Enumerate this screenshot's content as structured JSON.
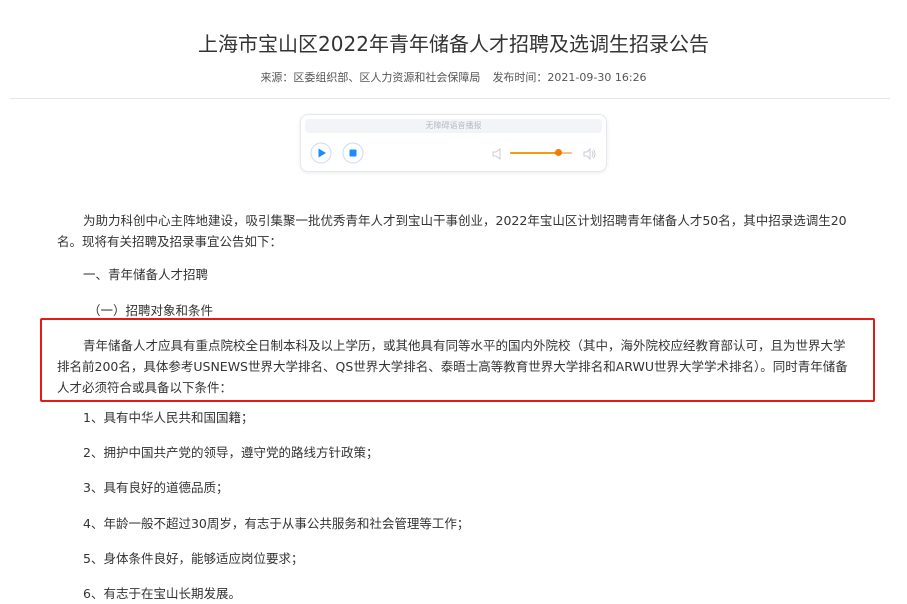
{
  "article": {
    "title": "上海市宝山区2022年青年储备人才招聘及选调生招录公告",
    "source_label": "来源：区委组织部、区人力资源和社会保障局",
    "publish_label": "发布时间：2021-09-30 16:26"
  },
  "player": {
    "banner": "无障碍语音播报",
    "play_icon": "play-icon",
    "stop_icon": "stop-icon",
    "volume_low_icon": "volume-low-icon",
    "volume_high_icon": "volume-high-icon",
    "volume_level": 0.78,
    "accent_color": "#f07d00",
    "button_color": "#1a8cff"
  },
  "body": {
    "intro": "为助力科创中心主阵地建设，吸引集聚一批优秀青年人才到宝山干事创业，2022年宝山区计划招聘青年储备人才50名，其中招录选调生20名。现将有关招聘及招录事宜公告如下：",
    "section_1": "一、青年储备人才招聘",
    "subsection_1": "（一）招聘对象和条件",
    "requirement": "青年储备人才应具有重点院校全日制本科及以上学历，或其他具有同等水平的国内外院校（其中，海外院校应经教育部认可，且为世界大学排名前200名，具体参考USNEWS世界大学排名、QS世界大学排名、泰晤士高等教育世界大学排名和ARWU世界大学学术排名）。同时青年储备人才必须符合或具备以下条件：",
    "conditions": [
      "1、具有中华人民共和国国籍；",
      "2、拥护中国共产党的领导，遵守党的路线方针政策；",
      "3、具有良好的道德品质；",
      "4、年龄一般不超过30周岁，有志于从事公共服务和社会管理等工作；",
      "5、身体条件良好，能够适应岗位要求；",
      "6、有志于在宝山长期发展。"
    ]
  },
  "annotation": {
    "highlight_color": "#e21a1a"
  }
}
